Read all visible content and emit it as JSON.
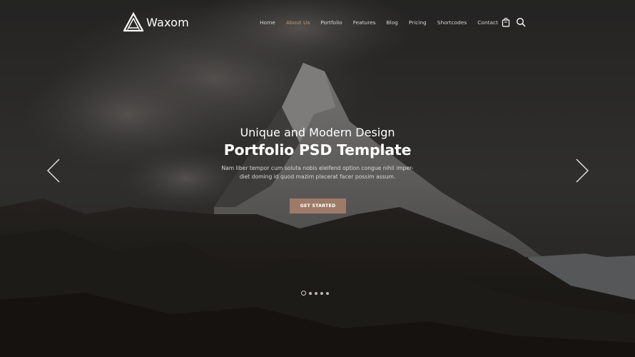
{
  "brand": {
    "name": "Waxom"
  },
  "nav": {
    "items": [
      "Home",
      "About Us",
      "Portfolio",
      "Features",
      "Blog",
      "Pricing",
      "Shortcodes",
      "Contact"
    ],
    "active_index": 1
  },
  "header_icons": [
    "cart-icon",
    "search-icon"
  ],
  "hero": {
    "subtitle": "Unique and Modern Design",
    "title": "Portfolio PSD Template",
    "description_line1": "Nam liber tempor cum soluta nobis eleifend option congue nihil imper-",
    "description_line2": "diet doming id quod mazim placerat facer possim assum.",
    "cta_label": "GET STARTED"
  },
  "slider": {
    "slide_count": 5,
    "active_slide": 1
  },
  "colors": {
    "accent": "#c49a74",
    "button": "#9e7b68",
    "text": "#ffffff"
  }
}
